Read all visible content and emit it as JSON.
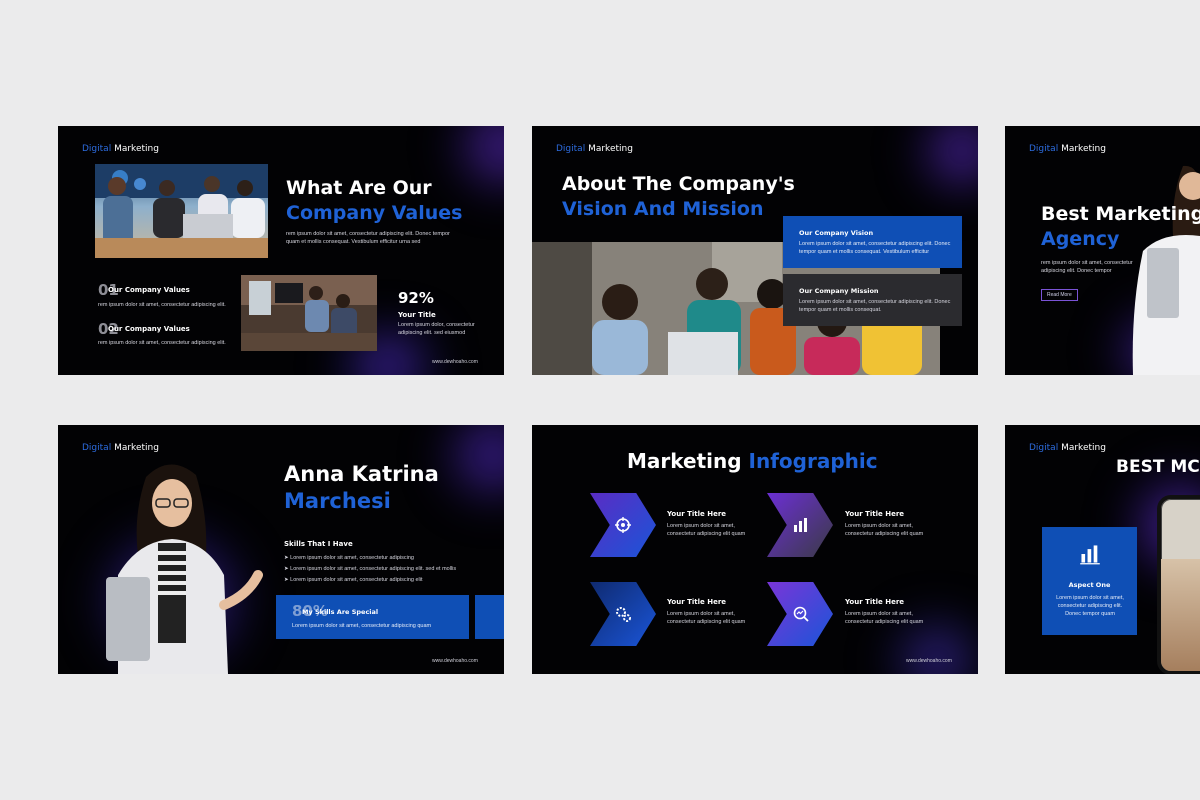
{
  "colors": {
    "page_bg": "#ebebec",
    "slide_bg": "#020204",
    "accent_blue": "#1f62d6",
    "accent_purple": "#6b2fd1"
  },
  "slides": {
    "values": {
      "brand_a": "Digital",
      "brand_b": "Marketing",
      "title_white": "What Are Our",
      "title_blue": "Company Values",
      "intro": "rem ipsum dolor sit amet, consectetur adipiscing elit. Donec tempor quam et mollis consequat. Vestibulum efficitur urna sed",
      "item1_num": "01",
      "item1_title": "Our Company Values",
      "item1_text": "rem ipsum dolor sit amet, consectetur adipiscing elit.",
      "item2_num": "02",
      "item2_title": "Our Company Values",
      "item2_text": "rem ipsum dolor sit amet, consectetur adipiscing elit.",
      "stat_value": "92%",
      "stat_title": "Your Title",
      "stat_text": "Lorem ipsum dolor, consectetur adipiscing elit. sed eiusmod",
      "footer": "www.dewhoaho.com"
    },
    "vision": {
      "brand_a": "Digital",
      "brand_b": "Marketing",
      "title_white": "About The Company's",
      "title_blue": "Vision And Mission",
      "vision_title": "Our Company Vision",
      "vision_text": "Lorem ipsum dolor sit amet, consectetur adipiscing elit. Donec tempor quam et mollis consequat. Vestibulum efficitur",
      "mission_title": "Our Company Mission",
      "mission_text": "Lorem ipsum dolor sit amet, consectetur adipiscing elit. Donec tempor quam et mollis consequat."
    },
    "agency": {
      "brand_a": "Digital",
      "brand_b": "Marketing",
      "title_white": "Best Marketing",
      "title_blue": "Agency",
      "text": "rem ipsum dolor sit amet, consectetur adipiscing elit. Donec tempor",
      "button": "Read More"
    },
    "profile": {
      "brand_a": "Digital",
      "brand_b": "Marketing",
      "name_white": "Anna Katrina",
      "name_blue": "Marchesi",
      "skills_title": "Skills That I Have",
      "skills": [
        "Lorem ipsum dolor sit amet, consectetur adipiscing",
        "Lorem ipsum dolor sit amet, consectetur adipiscing elit. sed et mollis",
        "Lorem ipsum dolor sit amet, consectetur adipiscing elit"
      ],
      "special_num": "80%",
      "special_title": "My Skills Are Special",
      "special_text": "Lorem ipsum dolor sit amet, consectetur adipiscing quam",
      "footer": "www.dewhoaho.com"
    },
    "infographic": {
      "title_white": "Marketing",
      "title_blue": "Infographic",
      "items": [
        {
          "title": "Your Title Here",
          "text1": "Lorem ipsum dolor sit amet,",
          "text2": "consectetur adipiscing elit quam",
          "icon": "target-icon"
        },
        {
          "title": "Your Title Here",
          "text1": "Lorem ipsum dolor sit amet,",
          "text2": "consectetur adipiscing elit quam",
          "icon": "bar-chart-icon"
        },
        {
          "title": "Your Title Here",
          "text1": "Lorem ipsum dolor sit amet,",
          "text2": "consectetur adipiscing elit quam",
          "icon": "gears-icon"
        },
        {
          "title": "Your Title Here",
          "text1": "Lorem ipsum dolor sit amet,",
          "text2": "consectetur adipiscing elit quam",
          "icon": "magnifier-chart-icon"
        }
      ],
      "footer": "www.dewhoaho.com"
    },
    "aspect": {
      "brand_a": "Digital",
      "brand_b": "Marketing",
      "title": "BEST MC",
      "card_title": "Aspect One",
      "card_text": "Lorem ipsum dolor sit amet, consectetur adipiscing elit. Donec tempor quam"
    }
  }
}
